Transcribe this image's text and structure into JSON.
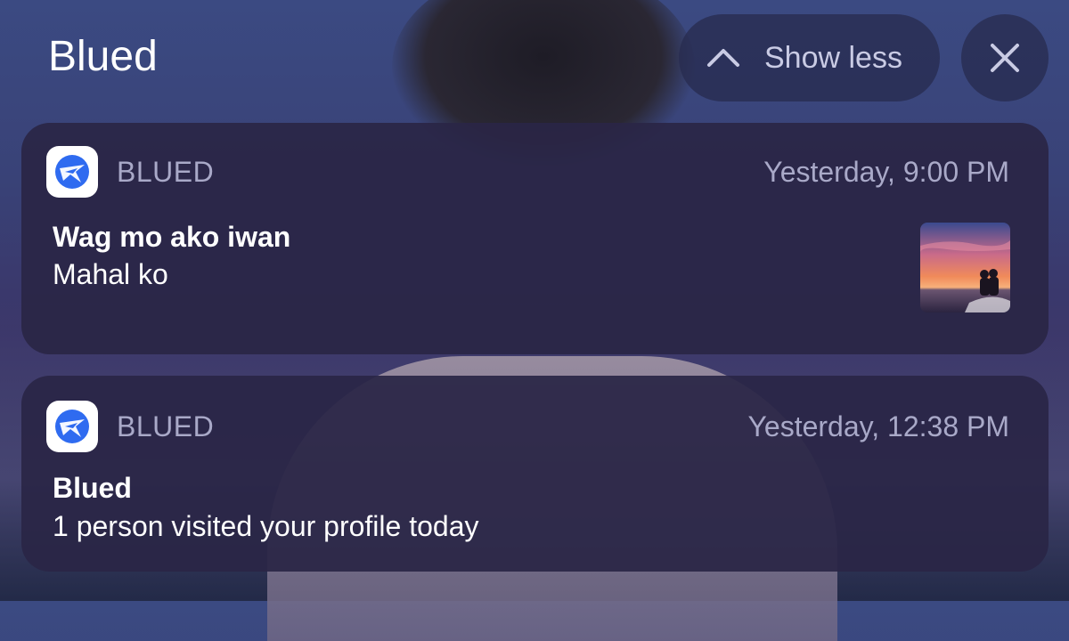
{
  "group": {
    "title": "Blued",
    "show_less_label": "Show less",
    "chevron_icon": "chevron-up-icon",
    "close_icon": "close-icon"
  },
  "notifications": [
    {
      "app_name": "BLUED",
      "time": "Yesterday, 9:00 PM",
      "title": "Wag mo ako iwan",
      "body": "Mahal ko",
      "has_thumbnail": true
    },
    {
      "app_name": "BLUED",
      "time": "Yesterday, 12:38 PM",
      "title": "Blued",
      "body": "1 person visited your profile today",
      "has_thumbnail": false
    }
  ],
  "colors": {
    "card_bg": "#2a2646",
    "secondary_text": "#a9a9c8",
    "brand_blue": "#2f6bf0"
  }
}
